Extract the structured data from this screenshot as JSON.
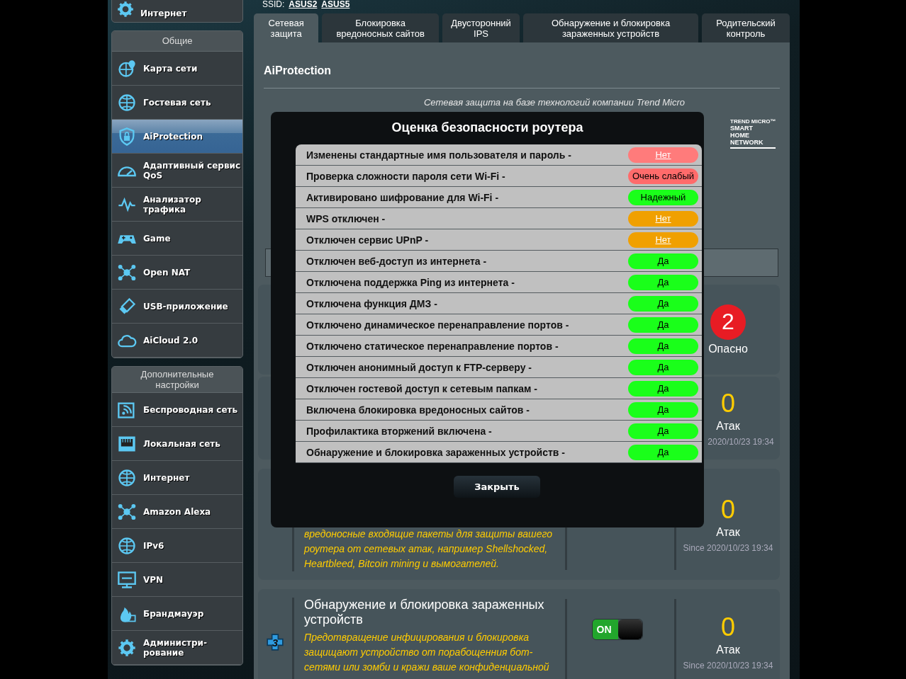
{
  "header": {
    "ssid_label": "SSID:",
    "ssids": [
      "ASUS2",
      "ASUS5"
    ]
  },
  "quick_setup": {
    "label": "Интернет"
  },
  "sidebar": {
    "sections": [
      {
        "title": "Общие",
        "items": [
          {
            "label": "Карта сети",
            "selected": false
          },
          {
            "label": "Гостевая сеть",
            "selected": false
          },
          {
            "label": "AiProtection",
            "selected": true
          },
          {
            "label": "Адаптивный сервис QoS",
            "selected": false
          },
          {
            "label": "Анализатор трафика",
            "selected": false
          },
          {
            "label": "Game",
            "selected": false
          },
          {
            "label": "Open NAT",
            "selected": false
          },
          {
            "label": "USB-приложение",
            "selected": false
          },
          {
            "label": "AiCloud 2.0",
            "selected": false
          }
        ]
      },
      {
        "title": "Дополнительные настройки",
        "items": [
          {
            "label": "Беспроводная сеть",
            "selected": false
          },
          {
            "label": "Локальная сеть",
            "selected": false
          },
          {
            "label": "Интернет",
            "selected": false
          },
          {
            "label": "Amazon Alexa",
            "selected": false
          },
          {
            "label": "IPv6",
            "selected": false
          },
          {
            "label": "VPN",
            "selected": false
          },
          {
            "label": "Брандмауэр",
            "selected": false
          },
          {
            "label": "Администри-\nрование",
            "selected": false
          }
        ]
      }
    ]
  },
  "tabs": [
    {
      "label": "Сетевая\nзащита",
      "selected": true
    },
    {
      "label": "Блокировка\nвредоносных сайтов",
      "selected": false
    },
    {
      "label": "Двусторонний\nIPS",
      "selected": false
    },
    {
      "label": "Обнаружение и блокировка\nзараженных устройств",
      "selected": false
    },
    {
      "label": "Родительский\nконтроль",
      "selected": false
    }
  ],
  "page": {
    "title": "AiProtection",
    "intro": "Сетевая защита на базе технологий компании Trend Micro",
    "logo": [
      "TREND MICRO™",
      "SMART",
      "HOME",
      "NETWORK"
    ]
  },
  "cards": [
    {
      "kind": "risk",
      "stat": "2",
      "stat_label": "Опасно"
    },
    {
      "kind": "attacks",
      "stat": "0",
      "stat_label": "Атак",
      "since": "2020/10/23 19:34"
    },
    {
      "kind": "attacks",
      "description": "вредоносные входящие пакеты для защиты вашего роутера от сетевых атак, например Shellshocked, Heartbleed, Bitcoin mining и вымогателей.",
      "stat": "0",
      "stat_label": "Атак",
      "since": "Since 2020/10/23 19:34"
    },
    {
      "kind": "attacks",
      "badge": "3",
      "title": "Обнаружение и блокировка зараженных устройств",
      "description": "Предотвращение инфицирования и блокировка защищают устройство от порабощенния бот-сетями или зомби и кражи ваше конфиденциальной",
      "toggle": {
        "label": "ON",
        "on": true
      },
      "stat": "0",
      "stat_label": "Атак",
      "since": "Since 2020/10/23 19:34"
    }
  ],
  "modal": {
    "title": "Оценка безопасности роутера",
    "close_button": "Закрыть",
    "rows": [
      {
        "label": "Изменены стандартные имя пользователя и пароль -",
        "value": "Нет",
        "color": "#ff7b7b",
        "link": true
      },
      {
        "label": "Проверка сложности пароля сети Wi-Fi -",
        "value": "Очень слабый",
        "color": "#ff6b6b",
        "link": false
      },
      {
        "label": "Активировано шифрование для Wi-Fi -",
        "value": "Надежный",
        "color": "#1aff1a",
        "link": false
      },
      {
        "label": "WPS отключен -",
        "value": "Нет",
        "color": "#f0a000",
        "link": true
      },
      {
        "label": "Отключен сервис UPnP -",
        "value": "Нет",
        "color": "#f0a000",
        "link": true
      },
      {
        "label": "Отключен веб-доступ из интернета -",
        "value": "Да",
        "color": "#1aff1a",
        "link": false
      },
      {
        "label": "Отключена поддержка Ping из интернета -",
        "value": "Да",
        "color": "#1aff1a",
        "link": false
      },
      {
        "label": "Отключена функция ДМЗ -",
        "value": "Да",
        "color": "#1aff1a",
        "link": false
      },
      {
        "label": "Отключено динамическое перенаправление портов -",
        "value": "Да",
        "color": "#1aff1a",
        "link": false
      },
      {
        "label": "Отключено статическое перенаправление портов -",
        "value": "Да",
        "color": "#1aff1a",
        "link": false
      },
      {
        "label": "Отключен анонимный доступ к FTP-серверу -",
        "value": "Да",
        "color": "#1aff1a",
        "link": false
      },
      {
        "label": "Отключен гостевой доступ к сетевым папкам -",
        "value": "Да",
        "color": "#1aff1a",
        "link": false
      },
      {
        "label": "Включена блокировка вредоносных сайтов -",
        "value": "Да",
        "color": "#1aff1a",
        "link": false
      },
      {
        "label": "Профилактика вторжений включена -",
        "value": "Да",
        "color": "#1aff1a",
        "link": false
      },
      {
        "label": "Обнаружение и блокировка зараженных устройств -",
        "value": "Да",
        "color": "#1aff1a",
        "link": false
      }
    ]
  }
}
